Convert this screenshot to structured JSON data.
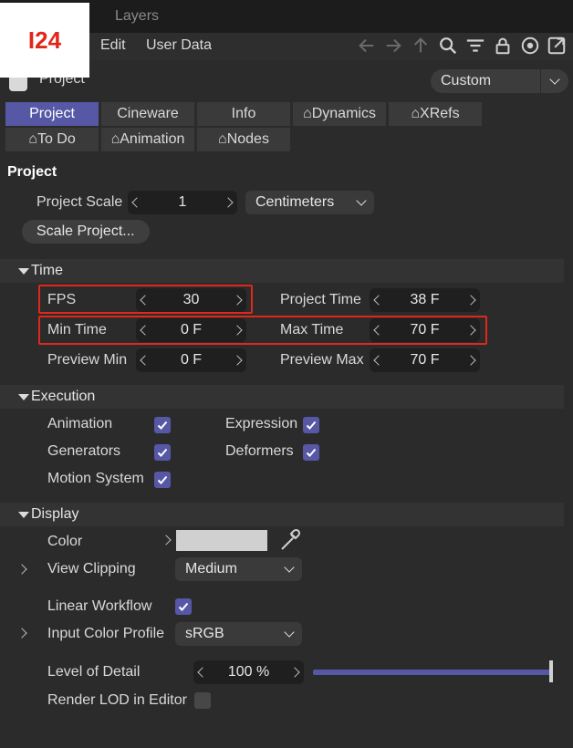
{
  "logo": {
    "text": "I24"
  },
  "top_tabs": {
    "layers": "Layers"
  },
  "menu": {
    "edit": "Edit",
    "user_data": "User Data"
  },
  "toolbar_icons": [
    "arrow-left-icon",
    "arrow-right-icon",
    "arrow-up-icon",
    "search-icon",
    "filter-icon",
    "lock-icon",
    "target-icon",
    "external-link-icon"
  ],
  "header": {
    "title": "Project",
    "preset": "Custom"
  },
  "tabs": {
    "row1": [
      {
        "label": "Project",
        "active": true
      },
      {
        "label": "Cineware",
        "active": false
      },
      {
        "label": "Info",
        "active": false
      },
      {
        "label": "Dynamics",
        "active": false
      },
      {
        "label": "XRefs",
        "active": false
      }
    ],
    "row2": [
      {
        "label": "To Do",
        "active": false
      },
      {
        "label": "Animation",
        "active": false
      },
      {
        "label": "Nodes",
        "active": false
      }
    ]
  },
  "project": {
    "section": "Project",
    "scale_label": "Project Scale",
    "scale_value": "1",
    "scale_unit": "Centimeters",
    "scale_button": "Scale Project..."
  },
  "time": {
    "title": "Time",
    "fps_label": "FPS",
    "fps_value": "30",
    "project_time_label": "Project Time",
    "project_time_value": "38 F",
    "min_time_label": "Min Time",
    "min_time_value": "0 F",
    "max_time_label": "Max Time",
    "max_time_value": "70 F",
    "preview_min_label": "Preview Min",
    "preview_min_value": "0 F",
    "preview_max_label": "Preview Max",
    "preview_max_value": "70 F"
  },
  "execution": {
    "title": "Execution",
    "animation": "Animation",
    "expression": "Expression",
    "generators": "Generators",
    "deformers": "Deformers",
    "motion_system": "Motion System"
  },
  "display": {
    "title": "Display",
    "color_label": "Color",
    "view_clipping_label": "View Clipping",
    "view_clipping_value": "Medium",
    "linear_workflow_label": "Linear Workflow",
    "input_color_profile_label": "Input Color Profile",
    "input_color_profile_value": "sRGB",
    "lod_label": "Level of Detail",
    "lod_value": "100 %",
    "render_lod_label": "Render LOD in Editor"
  },
  "colors": {
    "accent": "#5658a6",
    "highlight": "#e0271b",
    "swatch": "#d0d0d0"
  }
}
